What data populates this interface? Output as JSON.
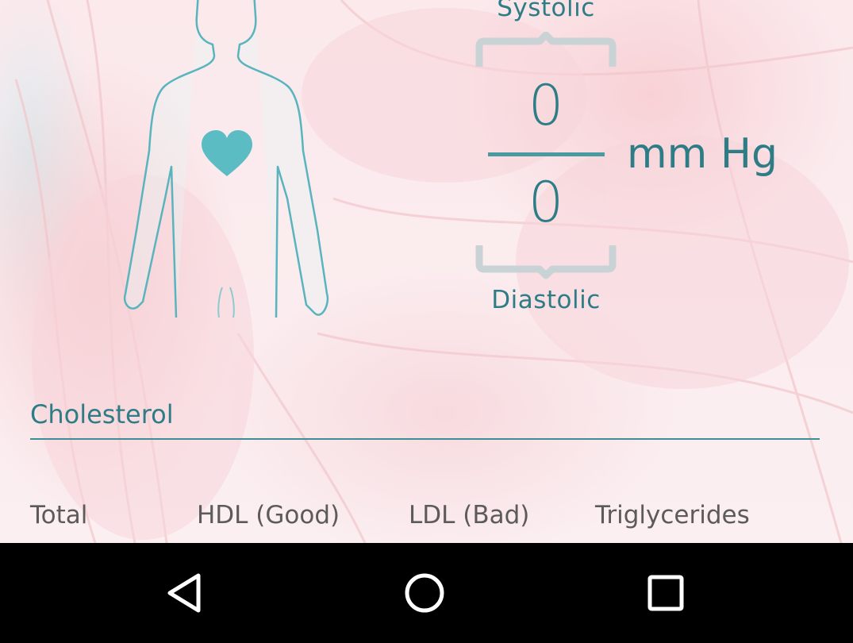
{
  "blood_pressure": {
    "systolic_label": "Systolic",
    "systolic_value": "0",
    "diastolic_label": "Diastolic",
    "diastolic_value": "0",
    "unit": "mm Hg"
  },
  "cholesterol": {
    "title": "Cholesterol",
    "columns": [
      "Total",
      "HDL (Good)",
      "LDL (Bad)",
      "Triglycerides"
    ]
  },
  "navigation": {
    "back_icon": "back-triangle-icon",
    "home_icon": "home-circle-icon",
    "recents_icon": "recents-square-icon"
  },
  "colors": {
    "accent": "#2e7d86",
    "heart": "#5cbcc4",
    "bracket": "#c9d3d6",
    "navbar": "#000000"
  }
}
